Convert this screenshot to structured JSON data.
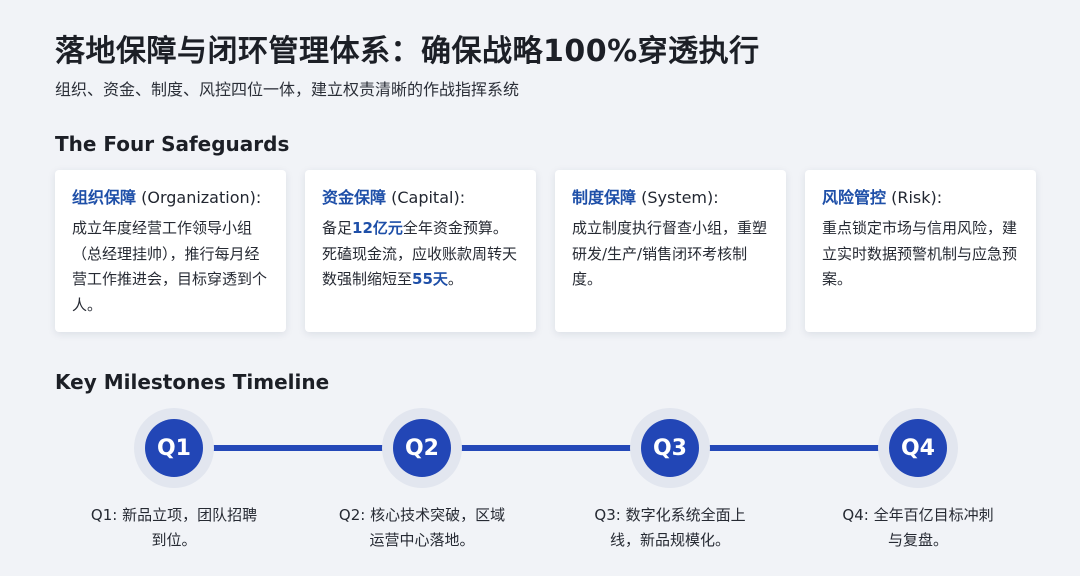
{
  "header": {
    "title": "落地保障与闭环管理体系：确保战略100%穿透执行",
    "subtitle": "组织、资金、制度、风控四位一体，建立权责清晰的作战指挥系统"
  },
  "safeguards": {
    "section_title": "The Four Safeguards",
    "cards": [
      {
        "title_zh": "组织保障",
        "title_en": " (Organization):",
        "body_segments": [
          {
            "text": "成立年度经营工作领导小组（总经理挂帅），推行每月经营工作推进会，目标穿透到个人。",
            "highlight": false
          }
        ]
      },
      {
        "title_zh": "资金保障",
        "title_en": " (Capital):",
        "body_segments": [
          {
            "text": "备足",
            "highlight": false
          },
          {
            "text": "12亿元",
            "highlight": true
          },
          {
            "text": "全年资金预算。死磕现金流，应收账款周转天数强制缩短至",
            "highlight": false
          },
          {
            "text": "55天",
            "highlight": true
          },
          {
            "text": "。",
            "highlight": false
          }
        ]
      },
      {
        "title_zh": "制度保障",
        "title_en": " (System):",
        "body_segments": [
          {
            "text": "成立制度执行督查小组，重塑研发/生产/销售闭环考核制度。",
            "highlight": false
          }
        ]
      },
      {
        "title_zh": "风险管控",
        "title_en": " (Risk):",
        "body_segments": [
          {
            "text": "重点锁定市场与信用风险，建立实时数据预警机制与应急预案。",
            "highlight": false
          }
        ]
      }
    ]
  },
  "timeline": {
    "section_title": "Key Milestones Timeline",
    "milestones": [
      {
        "label": "Q1",
        "caption_line1": "Q1: 新品立项，团队招聘",
        "caption_line2": "到位。"
      },
      {
        "label": "Q2",
        "caption_line1": "Q2: 核心技术突破，区域",
        "caption_line2": "运营中心落地。"
      },
      {
        "label": "Q3",
        "caption_line1": "Q3: 数字化系统全面上",
        "caption_line2": "线，新品规模化。"
      },
      {
        "label": "Q4",
        "caption_line1": "Q4: 全年百亿目标冲刺",
        "caption_line2": "与复盘。"
      }
    ]
  },
  "colors": {
    "accent": "#1e4fa8",
    "node_fill": "#2246b6",
    "background": "#f1f3f7"
  }
}
